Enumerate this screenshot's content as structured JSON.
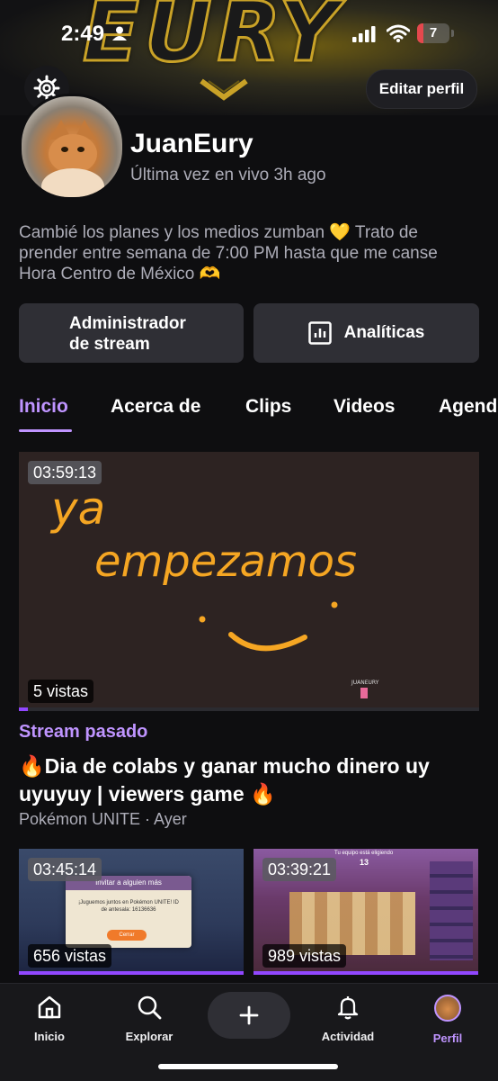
{
  "status_bar": {
    "time": "2:49",
    "battery": "7",
    "battery_level": 0.07
  },
  "banner": {
    "text": "EURY"
  },
  "header": {
    "settings_icon": "gear-icon",
    "edit_profile_label": "Editar perfil"
  },
  "profile": {
    "username": "JuanEury",
    "last_live": "Última vez en vivo 3h ago",
    "bio": "Cambié los planes y los medios zumban 💛 Trato de\nprender entre semana de 7:00 PM hasta que me canse\nHora Centro de México 🫶"
  },
  "actions": {
    "stream_manager_label": "Administrador\nde stream",
    "analytics_label": "Analíticas",
    "analytics_icon": "analytics-icon"
  },
  "tabs": [
    {
      "label": "Inicio",
      "active": true
    },
    {
      "label": "Acerca de",
      "active": false
    },
    {
      "label": "Clips",
      "active": false
    },
    {
      "label": "Videos",
      "active": false
    },
    {
      "label": "Agenda",
      "active": false
    }
  ],
  "featured_video": {
    "duration": "03:59:13",
    "views": "5 vistas",
    "drawing_text_1": "ya",
    "drawing_text_2": "empezamos",
    "watermark": "JUANEURY",
    "label": "Stream pasado",
    "title": "🔥Dia de colabs y ganar mucho dinero uy uyuyuy | viewers game 🔥",
    "meta": "Pokémon UNITE · Ayer",
    "progress": 0.02
  },
  "thumbnails": [
    {
      "duration": "03:45:14",
      "views": "656 vistas",
      "modal_title": "Invitar a alguien más",
      "modal_text": "¡Juguemos juntos en Pokémon UNITE! ID de antesala: 16136636",
      "modal_button": "Cerrar",
      "progress": 1.0
    },
    {
      "duration": "03:39:21",
      "views": "989 vistas",
      "header_text": "Tu equipo está eligiendo",
      "counter": "13",
      "progress": 1.0
    }
  ],
  "bottom_nav": [
    {
      "label": "Inicio",
      "icon": "home-icon",
      "active": false
    },
    {
      "label": "Explorar",
      "icon": "search-icon",
      "active": false
    },
    {
      "label": "",
      "icon": "plus-icon",
      "active": false
    },
    {
      "label": "Actividad",
      "icon": "bell-icon",
      "active": false
    },
    {
      "label": "Perfil",
      "icon": "avatar",
      "active": true
    }
  ],
  "colors": {
    "accent": "#bf94ff",
    "progress": "#9147ff",
    "background": "#0e0e10"
  }
}
